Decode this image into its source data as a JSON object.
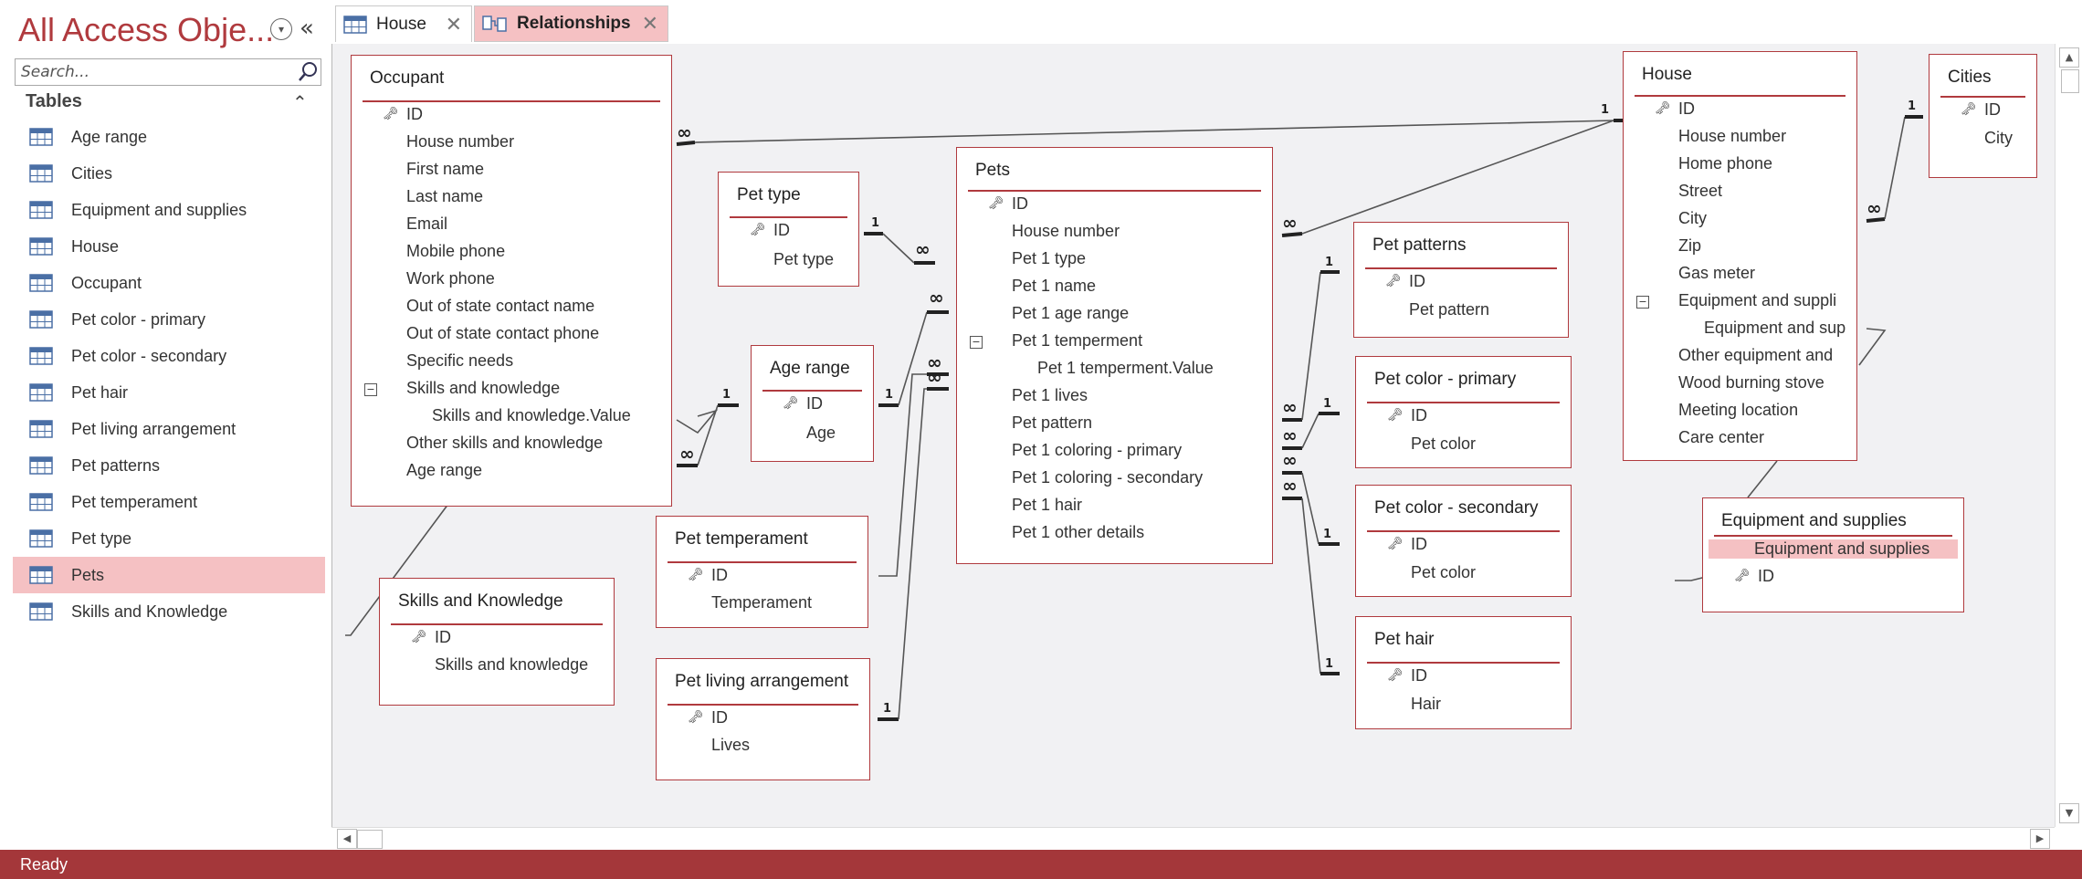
{
  "nav": {
    "title": "All Access Obje...",
    "search_placeholder": "Search...",
    "group_label": "Tables",
    "items": [
      {
        "label": "Age range"
      },
      {
        "label": "Cities"
      },
      {
        "label": "Equipment and supplies"
      },
      {
        "label": "House"
      },
      {
        "label": "Occupant"
      },
      {
        "label": "Pet color - primary"
      },
      {
        "label": "Pet color - secondary"
      },
      {
        "label": "Pet hair"
      },
      {
        "label": "Pet living arrangement"
      },
      {
        "label": "Pet patterns"
      },
      {
        "label": "Pet temperament"
      },
      {
        "label": "Pet type"
      },
      {
        "label": "Pets"
      },
      {
        "label": "Skills and Knowledge"
      }
    ],
    "active_item": "Pets"
  },
  "tabs": [
    {
      "label": "House"
    },
    {
      "label": "Relationships"
    }
  ],
  "status": "Ready",
  "tables": {
    "occupant": {
      "title": "Occupant",
      "fields": [
        "ID",
        "House number",
        "First name",
        "Last name",
        "Email",
        "Mobile phone",
        "Work phone",
        "Out of state contact name",
        "Out of state contact phone",
        "Specific needs",
        "Skills and knowledge",
        "Skills and knowledge.Value",
        "Other skills and knowledge",
        "Age range"
      ]
    },
    "pet_type": {
      "title": "Pet type",
      "fields": [
        "ID",
        "Pet type"
      ]
    },
    "age_range": {
      "title": "Age range",
      "fields": [
        "ID",
        "Age"
      ]
    },
    "pet_temperament": {
      "title": "Pet temperament",
      "fields": [
        "ID",
        "Temperament"
      ]
    },
    "pet_living": {
      "title": "Pet living arrangement",
      "fields": [
        "ID",
        "Lives"
      ]
    },
    "skills": {
      "title": "Skills and Knowledge",
      "fields": [
        "ID",
        "Skills and knowledge"
      ]
    },
    "pets": {
      "title": "Pets",
      "fields": [
        "ID",
        "House number",
        "Pet 1 type",
        "Pet 1 name",
        "Pet 1 age range",
        "Pet 1 temperment",
        "Pet 1 temperment.Value",
        "Pet 1 lives",
        "Pet pattern",
        "Pet 1 coloring - primary",
        "Pet 1 coloring - secondary",
        "Pet 1 hair",
        "Pet 1 other details"
      ]
    },
    "pet_patterns": {
      "title": "Pet patterns",
      "fields": [
        "ID",
        "Pet pattern"
      ]
    },
    "pet_color_primary": {
      "title": "Pet color - primary",
      "fields": [
        "ID",
        "Pet color"
      ]
    },
    "pet_color_secondary": {
      "title": "Pet color - secondary",
      "fields": [
        "ID",
        "Pet color"
      ]
    },
    "pet_hair": {
      "title": "Pet hair",
      "fields": [
        "ID",
        "Hair"
      ]
    },
    "house": {
      "title": "House",
      "fields": [
        "ID",
        "House number",
        "Home phone",
        "Street",
        "City",
        "Zip",
        "Gas meter",
        "Equipment and suppli",
        "Equipment and sup",
        "Other equipment and",
        "Wood burning stove",
        "Meeting location",
        "Care center"
      ]
    },
    "cities": {
      "title": "Cities",
      "fields": [
        "ID",
        "City"
      ]
    },
    "equipment": {
      "title": "Equipment and supplies",
      "fields": [
        "Equipment and supplies",
        "ID"
      ]
    }
  },
  "relationship_labels": {
    "one": "1",
    "many": "∞"
  },
  "colors": {
    "accent": "#b03a3e",
    "selection": "#f5c1c3",
    "status_bar": "#a4373a"
  }
}
